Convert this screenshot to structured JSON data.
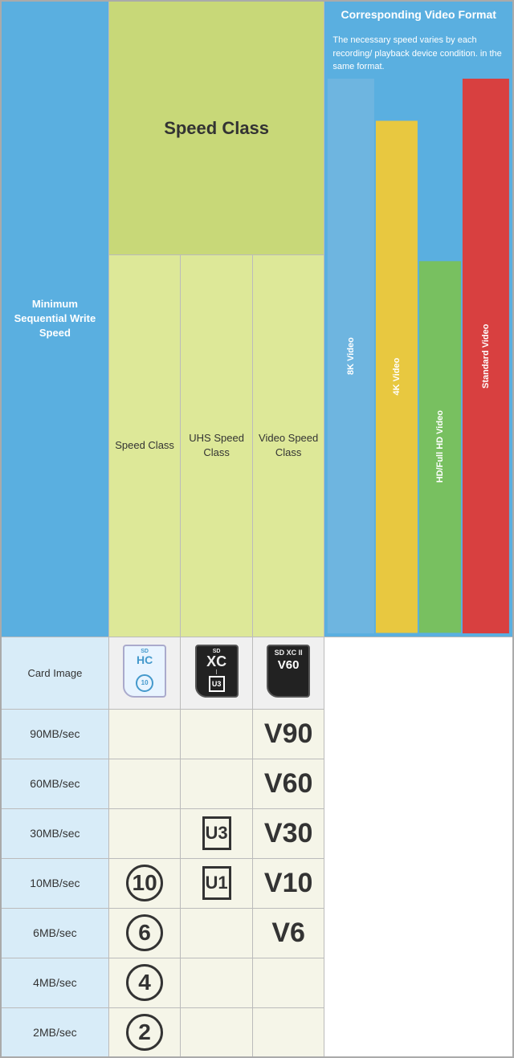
{
  "table": {
    "header": {
      "speed_class_label": "Speed Class",
      "corresponding_video_label": "Corresponding Video Format",
      "min_write_label": "Minimum Sequential Write Speed",
      "speed_class_col": "Speed Class",
      "uhs_speed_col": "UHS Speed Class",
      "video_speed_col": "Video Speed Class",
      "corresponding_detail": "The necessary speed varies by each recording/ playback device condition. in the same format."
    },
    "card_row": {
      "label": "Card Image",
      "card1": {
        "top": "SD",
        "sub": "HC",
        "badge": "C10"
      },
      "card2": {
        "top": "SD",
        "sub": "XC I",
        "badge": "U3"
      },
      "card3": {
        "top": "SD XC II",
        "badge": "V60"
      }
    },
    "rows": [
      {
        "speed": "90MB/sec",
        "speed_class": "",
        "uhs_class": "",
        "video_class": "V90"
      },
      {
        "speed": "60MB/sec",
        "speed_class": "",
        "uhs_class": "",
        "video_class": "V60"
      },
      {
        "speed": "30MB/sec",
        "speed_class": "",
        "uhs_class": "U3",
        "video_class": "V30"
      },
      {
        "speed": "10MB/sec",
        "speed_class": "C10",
        "uhs_class": "U1",
        "video_class": "V10"
      },
      {
        "speed": "6MB/sec",
        "speed_class": "C6",
        "uhs_class": "",
        "video_class": "V6"
      },
      {
        "speed": "4MB/sec",
        "speed_class": "C4",
        "uhs_class": "",
        "video_class": ""
      },
      {
        "speed": "2MB/sec",
        "speed_class": "C2",
        "uhs_class": "",
        "video_class": ""
      }
    ],
    "video_bars": [
      {
        "label": "8K Video",
        "color": "#6eb5e0",
        "rows": 4
      },
      {
        "label": "4K Video",
        "color": "#e8c840",
        "rows": 3
      },
      {
        "label": "HD/Full HD Video",
        "color": "#78c060",
        "rows": 4
      },
      {
        "label": "Standard Video",
        "color": "#d84040",
        "rows": 7
      }
    ]
  }
}
